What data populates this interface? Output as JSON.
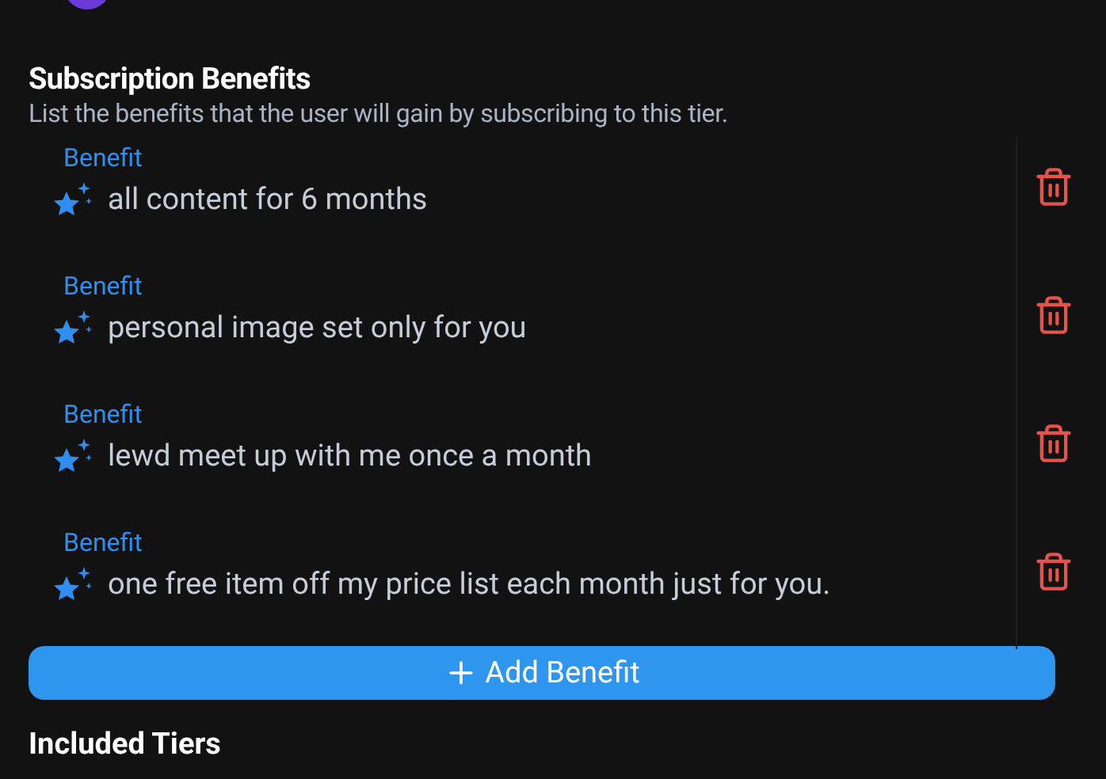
{
  "section": {
    "title": "Subscription Benefits",
    "description": "List the benefits that the user will gain by subscribing to this tier."
  },
  "benefits": [
    {
      "label": "Benefit",
      "value": "all content for 6 months"
    },
    {
      "label": "Benefit",
      "value": "personal image set only for you"
    },
    {
      "label": "Benefit",
      "value": "lewd meet up with me once a month"
    },
    {
      "label": "Benefit",
      "value": "one free item off my price list each month just for you."
    }
  ],
  "add_button": {
    "label": "Add Benefit"
  },
  "next_section": {
    "title": "Included Tiers"
  }
}
